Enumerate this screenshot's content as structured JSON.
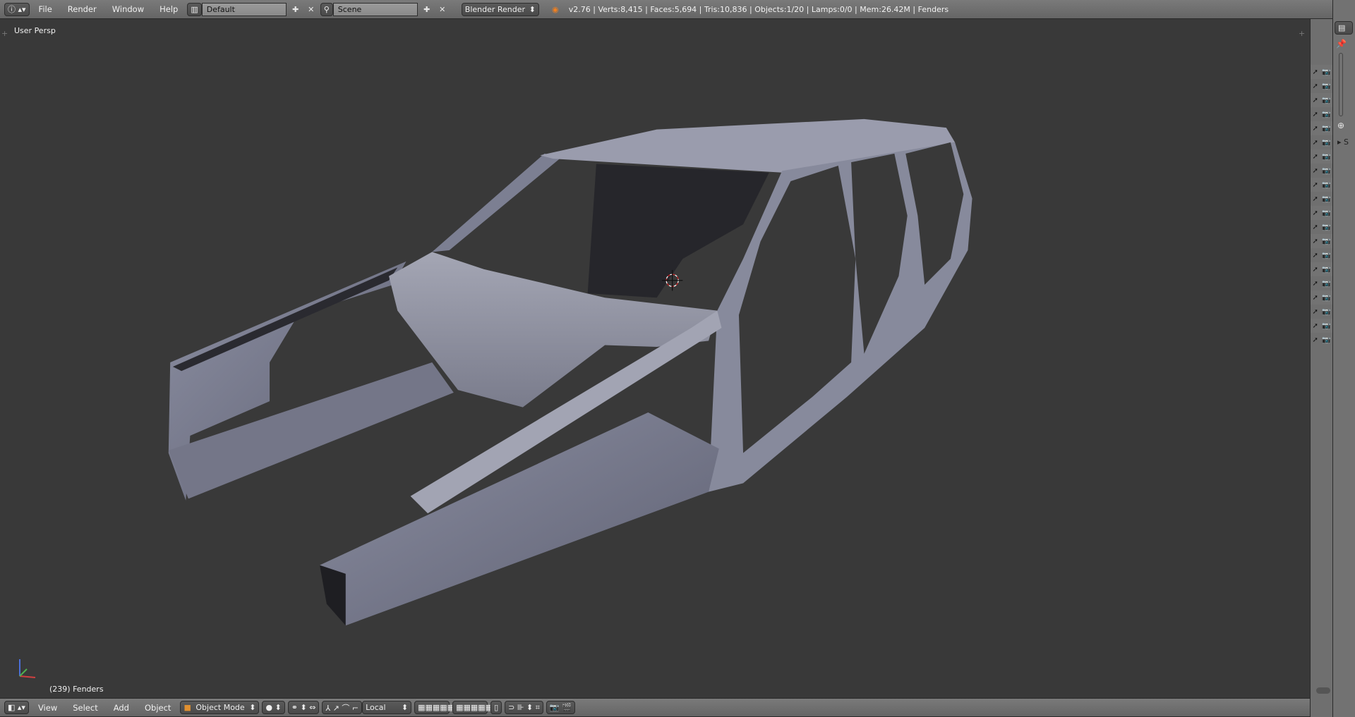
{
  "top_bar": {
    "menus": [
      "File",
      "Render",
      "Window",
      "Help"
    ],
    "screen_layout": "Default",
    "scene": "Scene",
    "render_engine": "Blender Render",
    "stats": "v2.76 | Verts:8,415 | Faces:5,694 | Tris:10,836 | Objects:1/20 | Lamps:0/0 | Mem:26.42M | Fenders"
  },
  "viewport": {
    "view_name": "User Persp",
    "object_info": "(239) Fenders"
  },
  "bottom_bar": {
    "menus": [
      "View",
      "Select",
      "Add",
      "Object"
    ],
    "mode": "Object Mode",
    "transform_orientation": "Local"
  },
  "outliner": {
    "row_count": 20
  },
  "properties": {
    "collapsed_label": "S"
  }
}
